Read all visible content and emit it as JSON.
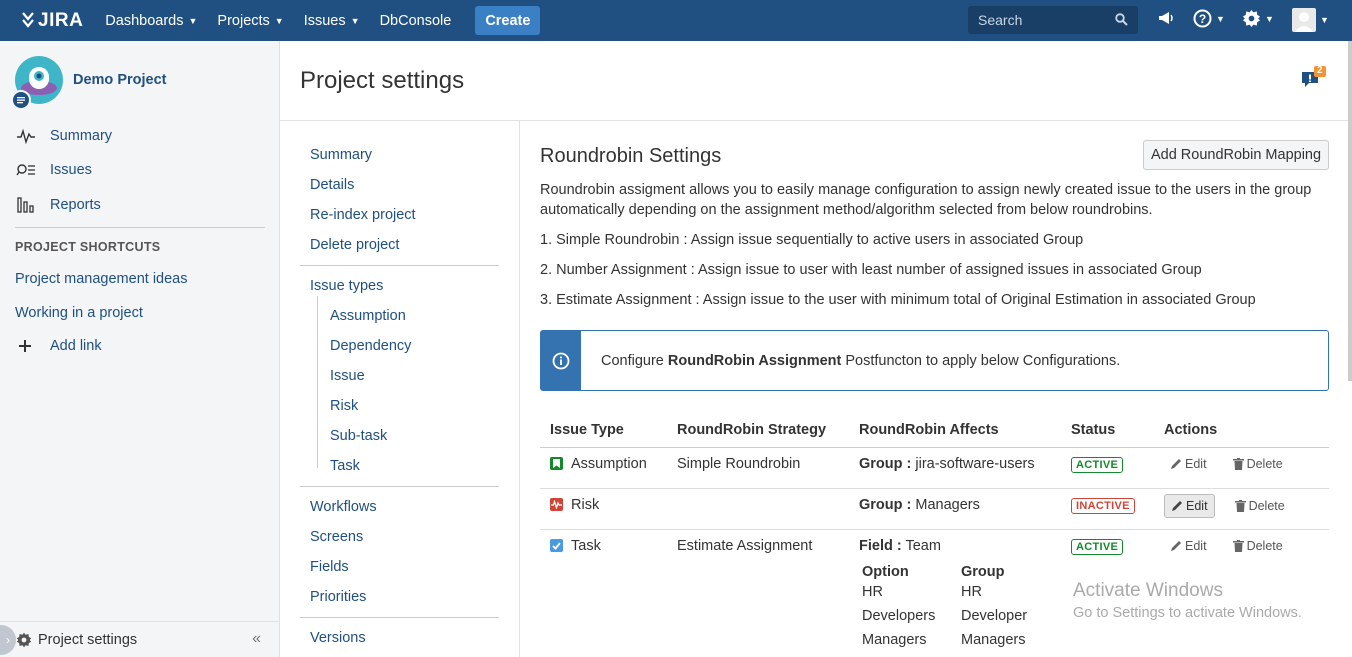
{
  "topnav": {
    "logo": "JIRA",
    "items": [
      "Dashboards",
      "Projects",
      "Issues"
    ],
    "dbconsole": "DbConsole",
    "create": "Create",
    "search_placeholder": "Search"
  },
  "sidebar": {
    "project_name": "Demo Project",
    "links": [
      "Summary",
      "Issues",
      "Reports"
    ],
    "shortcuts_title": "PROJECT SHORTCUTS",
    "shortcuts": [
      "Project management ideas",
      "Working in a project"
    ],
    "add_link": "Add link",
    "footer_label": "Project settings"
  },
  "page": {
    "title": "Project settings",
    "feedback_count": "2"
  },
  "settings_nav": {
    "group1": [
      "Summary",
      "Details",
      "Re-index project",
      "Delete project"
    ],
    "issue_types_label": "Issue types",
    "issue_types": [
      "Assumption",
      "Dependency",
      "Issue",
      "Risk",
      "Sub-task",
      "Task"
    ],
    "group3": [
      "Workflows",
      "Screens",
      "Fields",
      "Priorities"
    ],
    "versions": "Versions"
  },
  "content": {
    "title": "Roundrobin Settings",
    "add_button": "Add RoundRobin Mapping",
    "desc_line1": "Roundrobin assigment allows you to easily manage configuration to assign newly created issue to the users in the group",
    "desc_line2": "automatically depending on the assignment method/algorithm selected from below roundrobins.",
    "item1": "1. Simple Roundrobin : Assign issue sequentially to active users in associated Group",
    "item2": "2. Number Assignment : Assign issue to user with least number of assigned issues in associated Group",
    "item3": "3. Estimate Assignment : Assign issue to the user with minimum total of Original Estimation in associated Group",
    "info_pre": "Configure ",
    "info_bold": "RoundRobin Assignment",
    "info_post": " Postfuncton to apply below Configurations."
  },
  "table": {
    "headers": [
      "Issue Type",
      "RoundRobin Strategy",
      "RoundRobin Affects",
      "Status",
      "Actions"
    ],
    "rows": [
      {
        "type": "Assumption",
        "strategy": "Simple Roundrobin",
        "affects_key": "Group :",
        "affects_val": " jira-software-users",
        "status": "ACTIVE"
      },
      {
        "type": "Risk",
        "strategy": "",
        "affects_key": "Group :",
        "affects_val": " Managers",
        "status": "INACTIVE"
      },
      {
        "type": "Task",
        "strategy": "Estimate Assignment",
        "affects_key": "Field :",
        "affects_val": " Team",
        "status": "ACTIVE"
      }
    ],
    "edit": "Edit",
    "delete": "Delete",
    "option_header": "Option",
    "group_header": "Group",
    "options": [
      "HR",
      "Developers",
      "Managers"
    ],
    "groups": [
      "HR",
      "Developer",
      "Managers"
    ]
  },
  "watermark": {
    "line1": "Activate Windows",
    "line2": "Go to Settings to activate Windows."
  },
  "colors": {
    "header_bg": "#205081",
    "link": "#205081",
    "active": "#14892c",
    "inactive": "#d04437",
    "info": "#3572b0"
  }
}
